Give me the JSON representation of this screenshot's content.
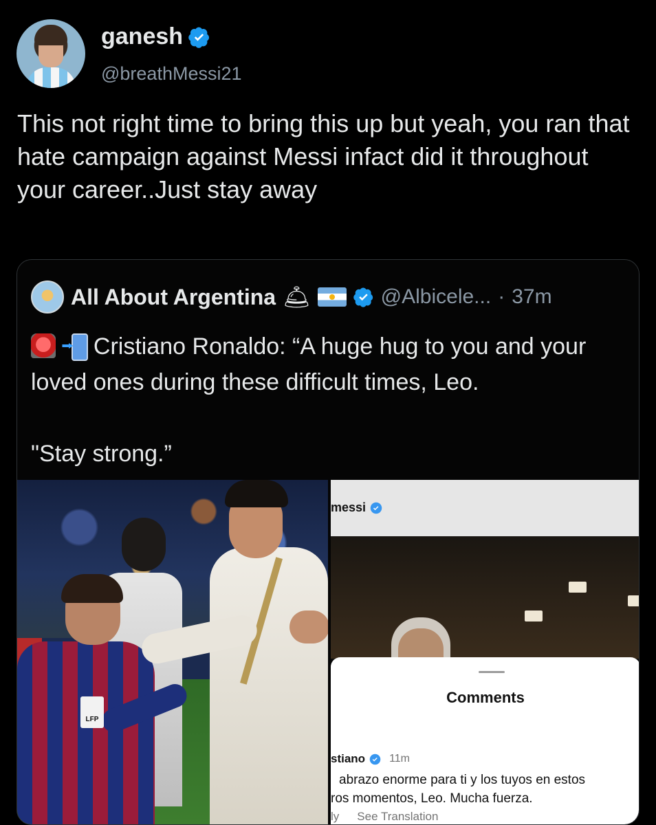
{
  "tweet": {
    "author_name": "ganesh",
    "author_handle": "@breathMessi21",
    "text": "This not right time to bring this up but yeah, you ran that hate campaign against Messi infact did it throughout your career..Just stay away"
  },
  "quoted_tweet": {
    "author_name": "All About Argentina",
    "author_emoji": "🛎",
    "handle": "@Albicele...",
    "separator": "·",
    "time": "37m",
    "text_line": "Cristiano Ronaldo: “A huge hug to you and your loved ones during these difficult times, Leo.",
    "text_line2": "\"Stay strong.”"
  },
  "instagram_screenshot": {
    "username_fragment": "messi",
    "comments_title": "Comments",
    "comment_user_fragment": "stiano",
    "comment_time": "11m",
    "comment_line1": "abrazo enorme para ti y los tuyos en estos",
    "comment_line2": "ros momentos, Leo. Mucha fuerza.",
    "reply_fragment": "ly",
    "see_translation": "See Translation"
  },
  "photo": {
    "badge_text": "LFP"
  },
  "colors": {
    "background": "#000000",
    "text_primary": "#e7e9ea",
    "text_secondary": "#8b98a5",
    "verified": "#1d9bf0",
    "border": "#2f3336"
  },
  "icons": [
    "verified-badge-icon",
    "bell-icon",
    "argentina-flag-icon",
    "siren-icon",
    "phone-arrow-icon"
  ]
}
